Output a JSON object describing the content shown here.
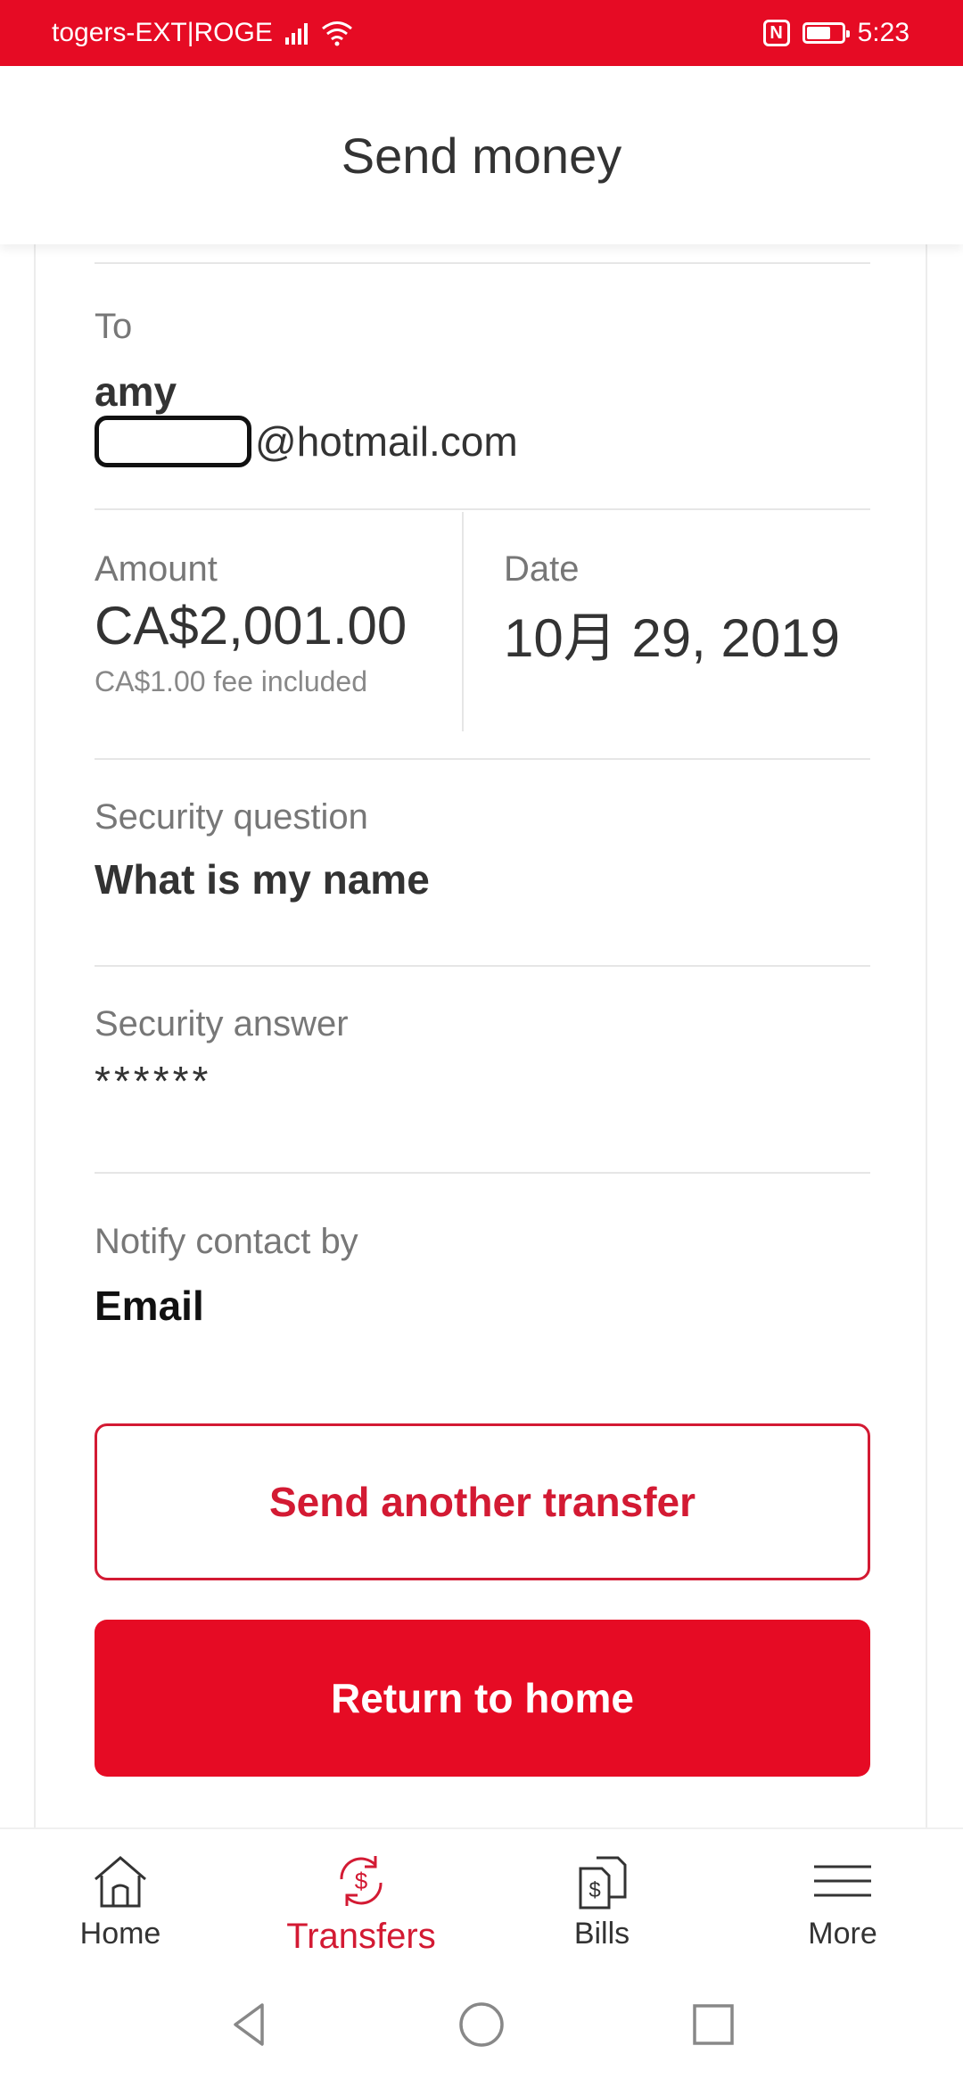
{
  "status_bar": {
    "carrier": "togers-EXT|ROGE",
    "time": "5:23"
  },
  "header": {
    "title": "Send money"
  },
  "transfer": {
    "to_label": "To",
    "recipient_name": "amy",
    "recipient_email_suffix": "@hotmail.com",
    "amount_label": "Amount",
    "amount_value": "CA$2,001.00",
    "fee_note": "CA$1.00 fee included",
    "date_label": "Date",
    "date_value": "10月 29, 2019",
    "security_question_label": "Security question",
    "security_question_value": "What is my name",
    "security_answer_label": "Security answer",
    "security_answer_value": "******",
    "notify_label": "Notify contact by",
    "notify_value": "Email"
  },
  "actions": {
    "send_another_label": "Send another transfer",
    "return_home_label": "Return to home"
  },
  "bottom_nav": {
    "items": [
      {
        "label": "Home",
        "icon": "home-icon"
      },
      {
        "label": "Transfers",
        "icon": "transfers-icon"
      },
      {
        "label": "Bills",
        "icon": "bills-icon"
      },
      {
        "label": "More",
        "icon": "menu-icon"
      }
    ],
    "active": "Transfers"
  },
  "colors": {
    "brand_red": "#e60b24",
    "accent_red": "#d31a33"
  }
}
